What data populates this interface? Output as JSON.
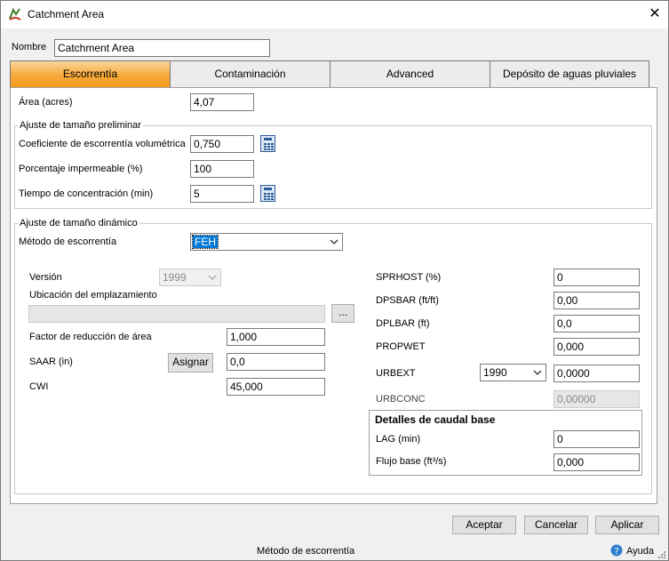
{
  "window": {
    "title": "Catchment Area",
    "close_glyph": "✕"
  },
  "nombre": {
    "label": "Nombre",
    "value": "Catchment Area"
  },
  "tabs": [
    {
      "label": "Escorrentía",
      "active": true
    },
    {
      "label": "Contaminación",
      "active": false
    },
    {
      "label": "Advanced",
      "active": false
    },
    {
      "label": "Depósito de aguas pluviales",
      "active": false
    }
  ],
  "area": {
    "label": "Área (acres)",
    "value": "4,07"
  },
  "preliminar": {
    "title": "Ajuste de tamaño preliminar",
    "coef_label": "Coeficiente de escorrentía volumétrica",
    "coef_value": "0,750",
    "imperm_label": "Porcentaje impermeable (%)",
    "imperm_value": "100",
    "tiempo_label": "Tiempo de concentración (min)",
    "tiempo_value": "5"
  },
  "dinamico": {
    "title": "Ajuste de tamaño dinámico",
    "metodo_label": "Método de escorrentía",
    "metodo_value": "FEH",
    "version_label": "Versión",
    "version_value": "1999",
    "ubicacion_label": "Ubicación del emplazamiento",
    "ubicacion_value": "",
    "browse_label": "...",
    "factor_label": "Factor de reducción de área",
    "factor_value": "1,000",
    "saar_label": "SAAR (in)",
    "asignar_label": "Asignar",
    "saar_value": "0,0",
    "cwi_label": "CWI",
    "cwi_value": "45,000",
    "sprhost_label": "SPRHOST (%)",
    "sprhost_value": "0",
    "dpsbar_label": "DPSBAR (ft/ft)",
    "dpsbar_value": "0,00",
    "dplbar_label": "DPLBAR (ft)",
    "dplbar_value": "0,0",
    "propwet_label": "PROPWET",
    "propwet_value": "0,000",
    "urbext_label": "URBEXT",
    "urbext_year": "1990",
    "urbext_value": "0,0000",
    "urbconc_label": "URBCONC",
    "urbconc_value": "0,00000"
  },
  "caudal": {
    "title": "Detalles de caudal base",
    "lag_label": "LAG (min)",
    "lag_value": "0",
    "flujo_label": "Flujo base (ft³/s)",
    "flujo_value": "0,000"
  },
  "buttons": {
    "aceptar": "Aceptar",
    "cancelar": "Cancelar",
    "aplicar": "Aplicar"
  },
  "status": {
    "text": "Método de escorrentía",
    "help": "Ayuda"
  },
  "colors": {
    "active_tab": "#f6a93a",
    "selection": "#0078d7",
    "calc_icon": "#2d5b9a"
  }
}
